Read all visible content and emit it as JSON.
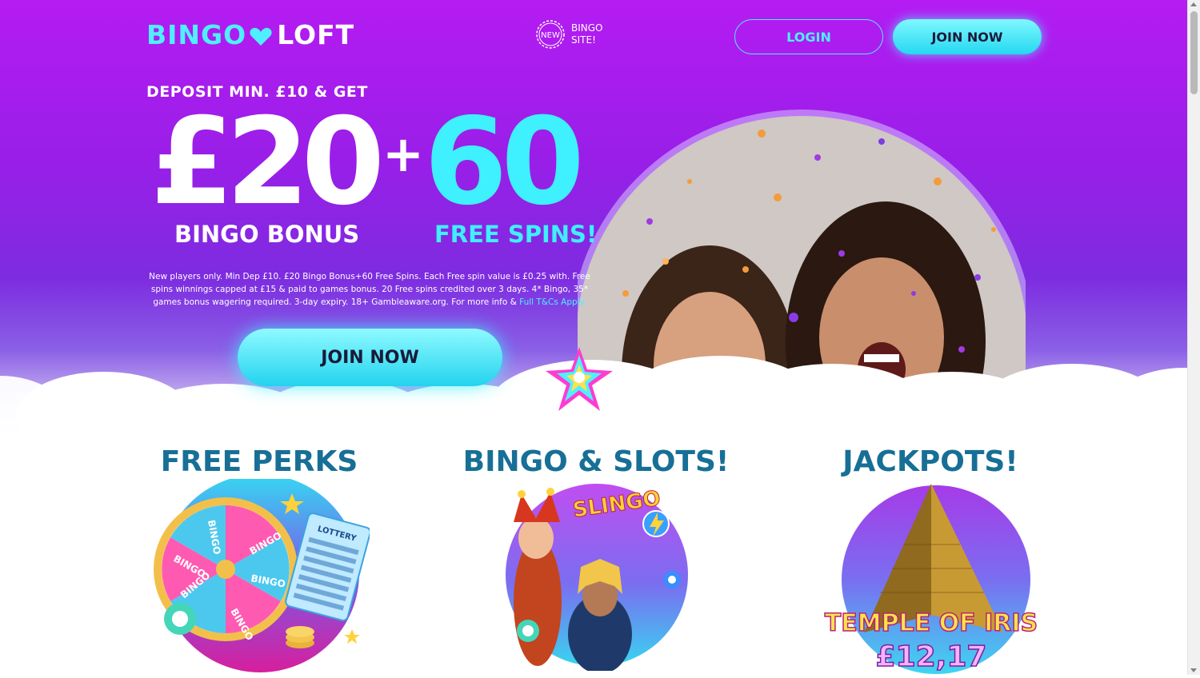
{
  "brand": {
    "part1": "BINGO",
    "part2": "LOFT"
  },
  "new_badge": {
    "seal": "NEW",
    "line1": "BINGO",
    "line2": "SITE!"
  },
  "header": {
    "login_label": "LOGIN",
    "join_label": "JOIN NOW"
  },
  "offer": {
    "pre": "DEPOSIT MIN. £10 & GET",
    "amount": "£20",
    "plus": "+",
    "spins_count": "60",
    "bonus_label": "BINGO BONUS",
    "spins_label": "FREE SPINS!",
    "terms_text": "New players only. Min Dep £10. £20 Bingo Bonus+60 Free Spins. Each Free spin value is £0.25 with. Free spins winnings capped at £15 & paid to games bonus. 20 Free spins credited over 3 days. 4* Bingo, 35* games bonus wagering required. 3-day expiry. 18+ Gambleaware.org. For more info &",
    "terms_link": "Full T&Cs Apply.",
    "cta_label": "JOIN NOW"
  },
  "sections": [
    {
      "title": "FREE PERKS",
      "wheel_labels": [
        "BINGO",
        "BINGO",
        "BINGO",
        "BINGO",
        "BINGO",
        "BINGO"
      ],
      "ticket_title": "LOTTERY"
    },
    {
      "title": "BINGO & SLOTS!",
      "game_logo": "SLINGO"
    },
    {
      "title": "JACKPOTS!",
      "game_name": "TEMPLE OF IRIS",
      "jackpot": "£12,17"
    }
  ],
  "colors": {
    "accent_cyan": "#3ff0ff",
    "hero_purple": "#a51ff0",
    "section_title": "#176f96"
  },
  "icons": [
    "heart-icon",
    "new-seal-icon",
    "gem-star-icon"
  ]
}
